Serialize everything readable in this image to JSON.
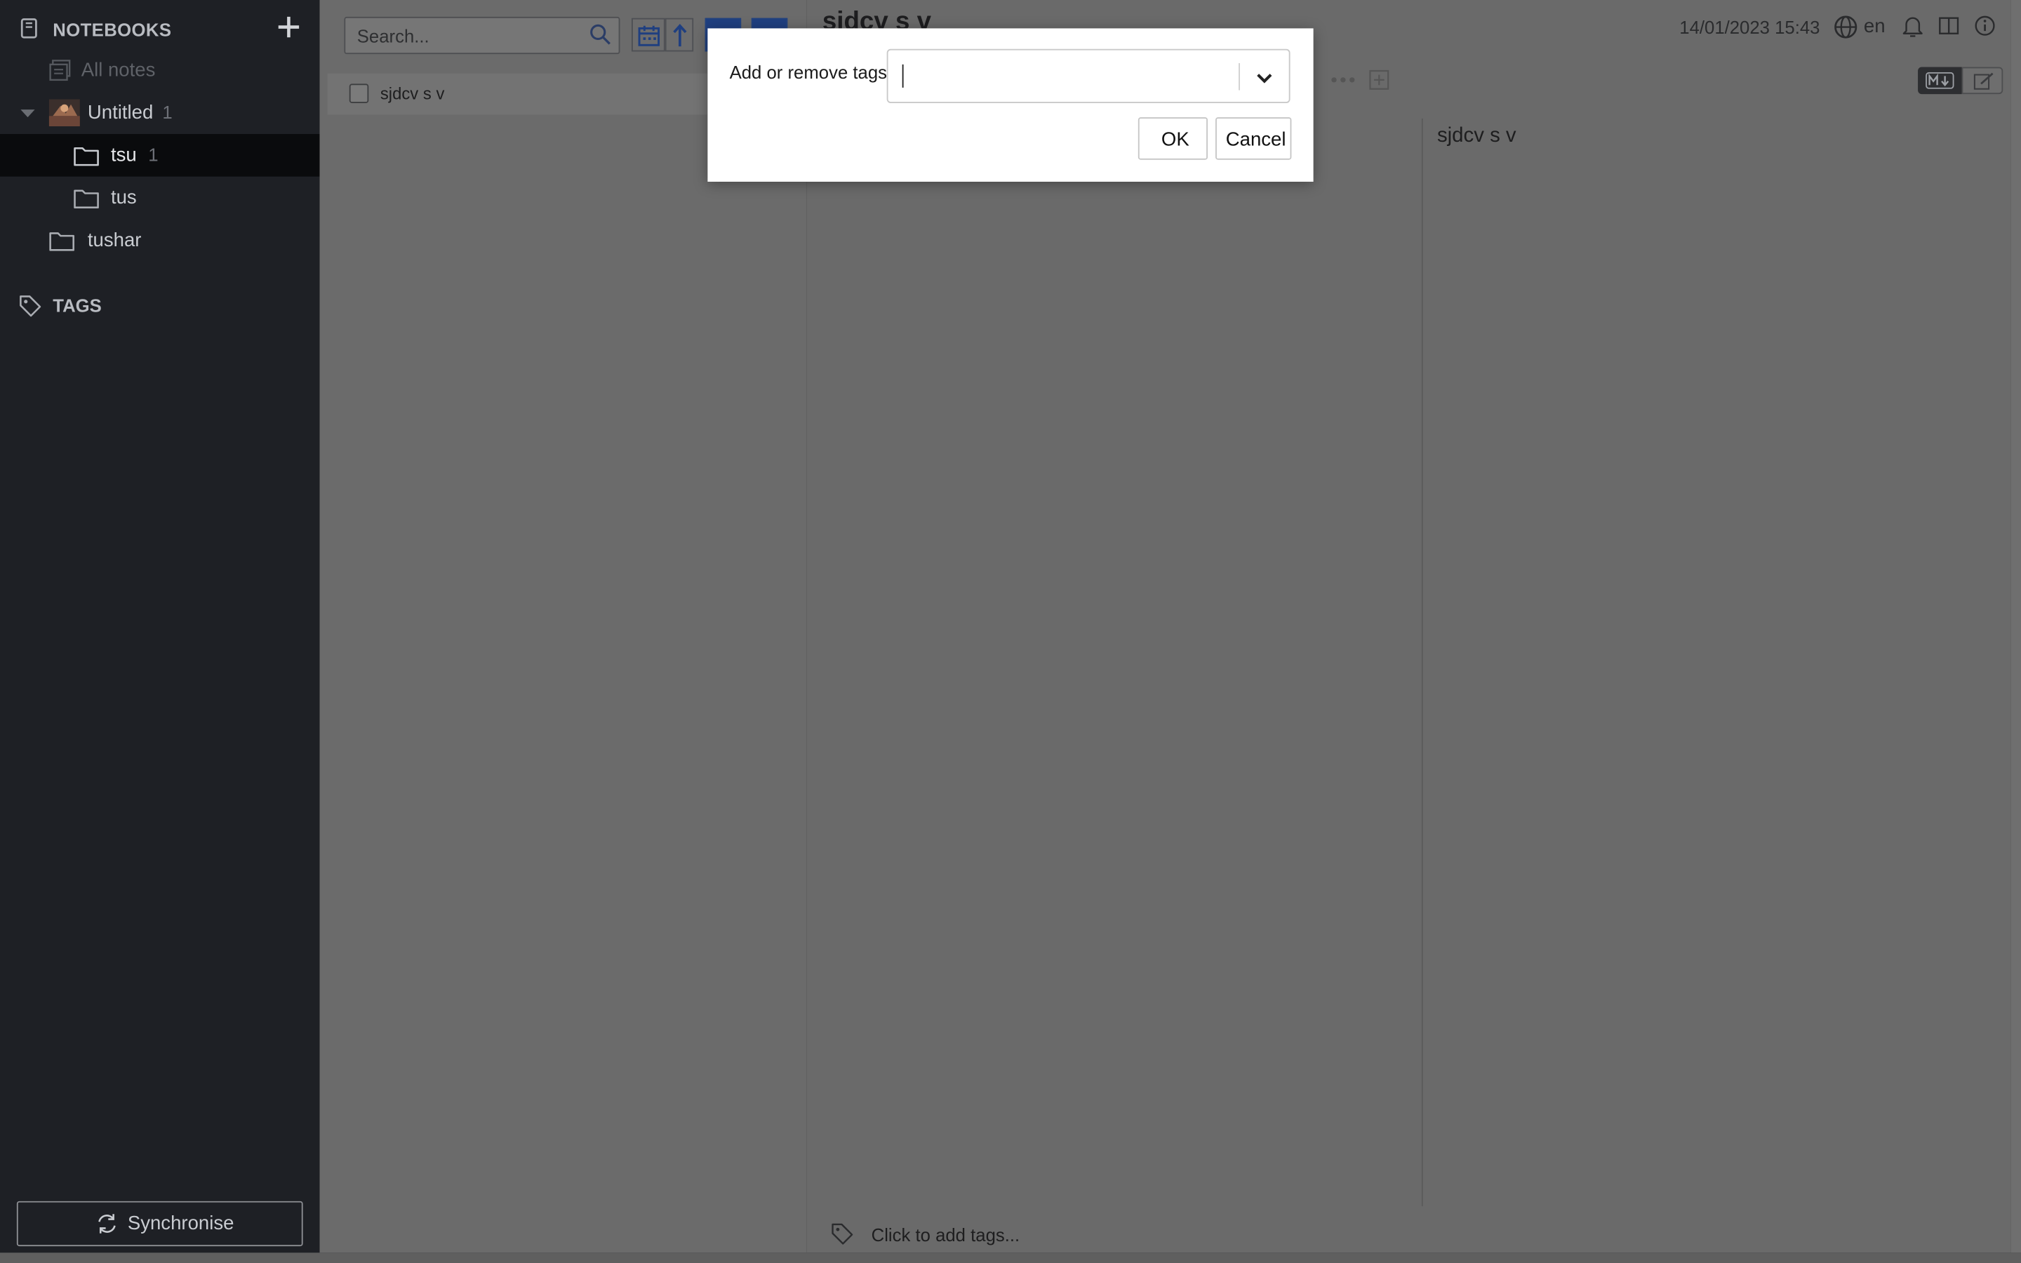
{
  "sidebar": {
    "header": {
      "title": "NOTEBOOKS"
    },
    "items": [
      {
        "label": "All notes",
        "count": ""
      },
      {
        "label": "Untitled",
        "count": "1"
      },
      {
        "label": "tsu",
        "count": "1"
      },
      {
        "label": "tus",
        "count": ""
      },
      {
        "label": "tushar",
        "count": ""
      }
    ],
    "tags_header": "TAGS",
    "sync_label": "Synchronise"
  },
  "note_list": {
    "search_placeholder": "Search...",
    "notes": [
      {
        "title": "sjdcv s v"
      }
    ]
  },
  "editor": {
    "title": "sjdcv s v",
    "datetime": "14/01/2023 15:43",
    "language": "en",
    "preview_text": "sjdcv s v",
    "tags_prompt": "Click to add tags..."
  },
  "dialog": {
    "prompt": "Add or remove tags:",
    "input_value": "",
    "ok_label": "OK",
    "cancel_label": "Cancel"
  },
  "colors": {
    "sidebar_bg": "#1e2025",
    "overlay_bg": "#6a6a6a",
    "accent_blue": "#1f3f80",
    "dialog_bg": "#ffffff"
  },
  "icons": {
    "notebook": "book-icon",
    "add": "plus-icon",
    "search": "search-icon",
    "sync": "refresh-icon",
    "tag": "tag-icon",
    "language": "globe-icon",
    "alarm": "bell-icon",
    "layout": "columns-icon",
    "info": "info-icon"
  }
}
